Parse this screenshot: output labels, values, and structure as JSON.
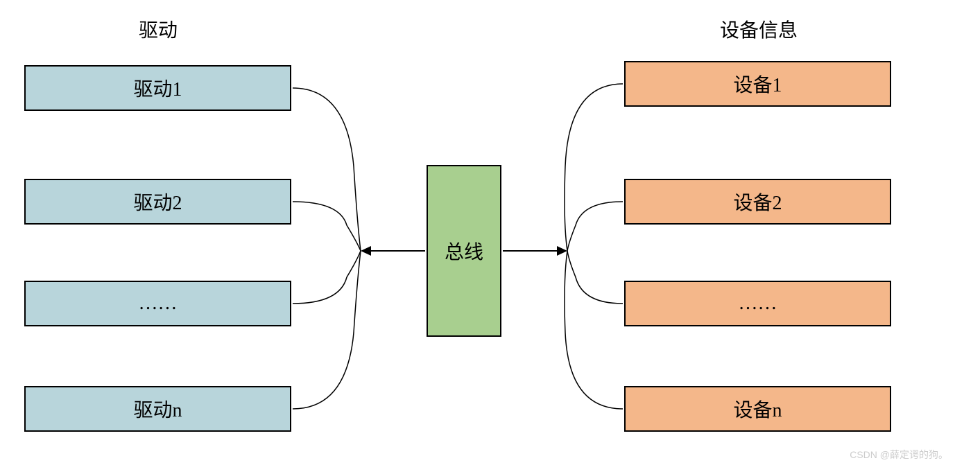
{
  "headers": {
    "driver": "驱动",
    "device": "设备信息"
  },
  "drivers": {
    "item1": "驱动1",
    "item2": "驱动2",
    "item3": "……",
    "item4": "驱动n"
  },
  "devices": {
    "item1": "设备1",
    "item2": "设备2",
    "item3": "……",
    "item4": "设备n"
  },
  "bus": {
    "label": "总线"
  },
  "watermark": "CSDN @薛定谔的狗。",
  "colors": {
    "driver_fill": "#b8d5db",
    "device_fill": "#f4b78a",
    "bus_fill": "#a8cf8f",
    "border": "#000000"
  }
}
